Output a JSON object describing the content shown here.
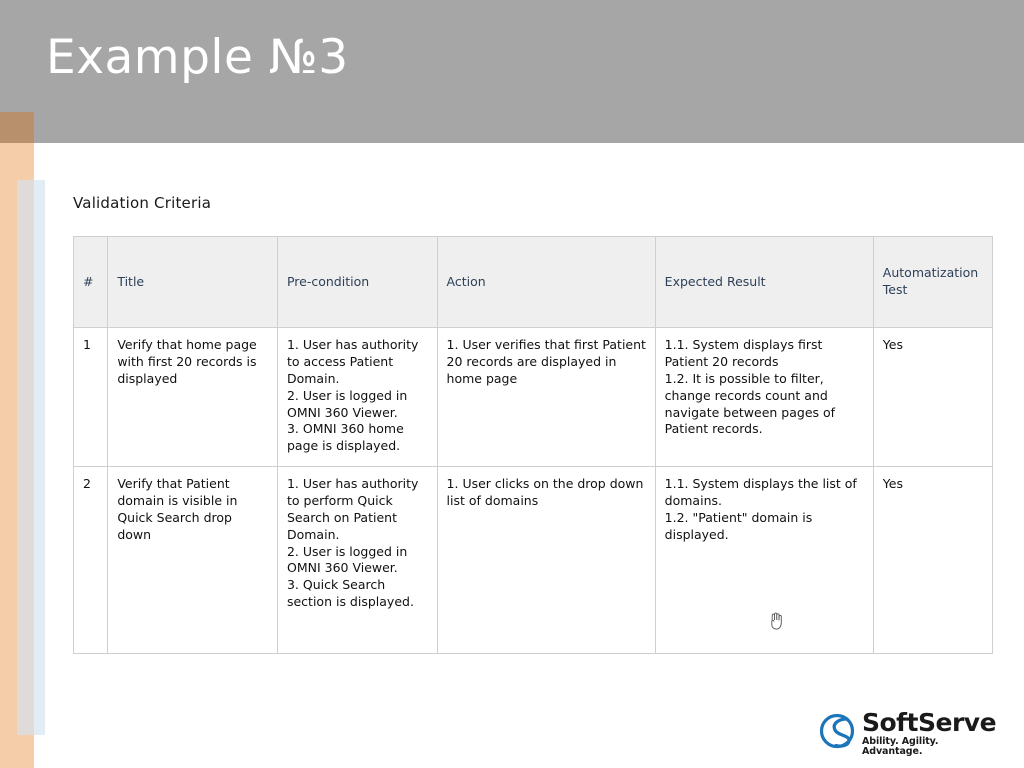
{
  "slide": {
    "title": "Example №3",
    "header_bg": "#a6a6a6",
    "accent_tan": "#b8906c",
    "accent_peach": "#f5cda8",
    "accent_bluegray": "#dedbd8",
    "accent_blueedge": "#e2ecf5"
  },
  "content": {
    "label": "Validation Criteria"
  },
  "table": {
    "headers": [
      "#",
      "Title",
      "Pre-condition",
      "Action",
      "Expected Result",
      "Automatization Test"
    ],
    "header_text_color": "#2e4158",
    "header_bg_color": "#efefef",
    "rows": [
      {
        "num": "1",
        "title": "Verify that home page with first 20 records is displayed",
        "precondition": "1. User has authority to access Patient Domain.\n2. User is logged in OMNI 360 Viewer.\n3. OMNI 360 home page is displayed.",
        "action": "1. User verifies that first Patient 20 records are displayed in home page",
        "expected": "1.1. System displays first Patient 20 records\n1.2. It is possible to filter, change records count and navigate between pages of Patient records.",
        "automatization": "Yes"
      },
      {
        "num": "2",
        "title": "Verify that Patient domain is visible in Quick Search drop down",
        "precondition": "1. User has authority to perform Quick Search on Patient Domain.\n2. User is logged in OMNI 360 Viewer.\n3. Quick Search section is displayed.",
        "action": "1. User clicks on the drop down list of domains",
        "expected": "1.1. System displays the list of domains.\n1.2. \"Patient\" domain is displayed.",
        "automatization": "Yes"
      }
    ]
  },
  "logo": {
    "word": "SoftServe",
    "tagline": "Ability. Agility. Advantage.",
    "mark_color": "#1b75bb",
    "text_color": "#1a1a1a"
  },
  "cursor": {
    "type": "grab-hand-cursor"
  }
}
